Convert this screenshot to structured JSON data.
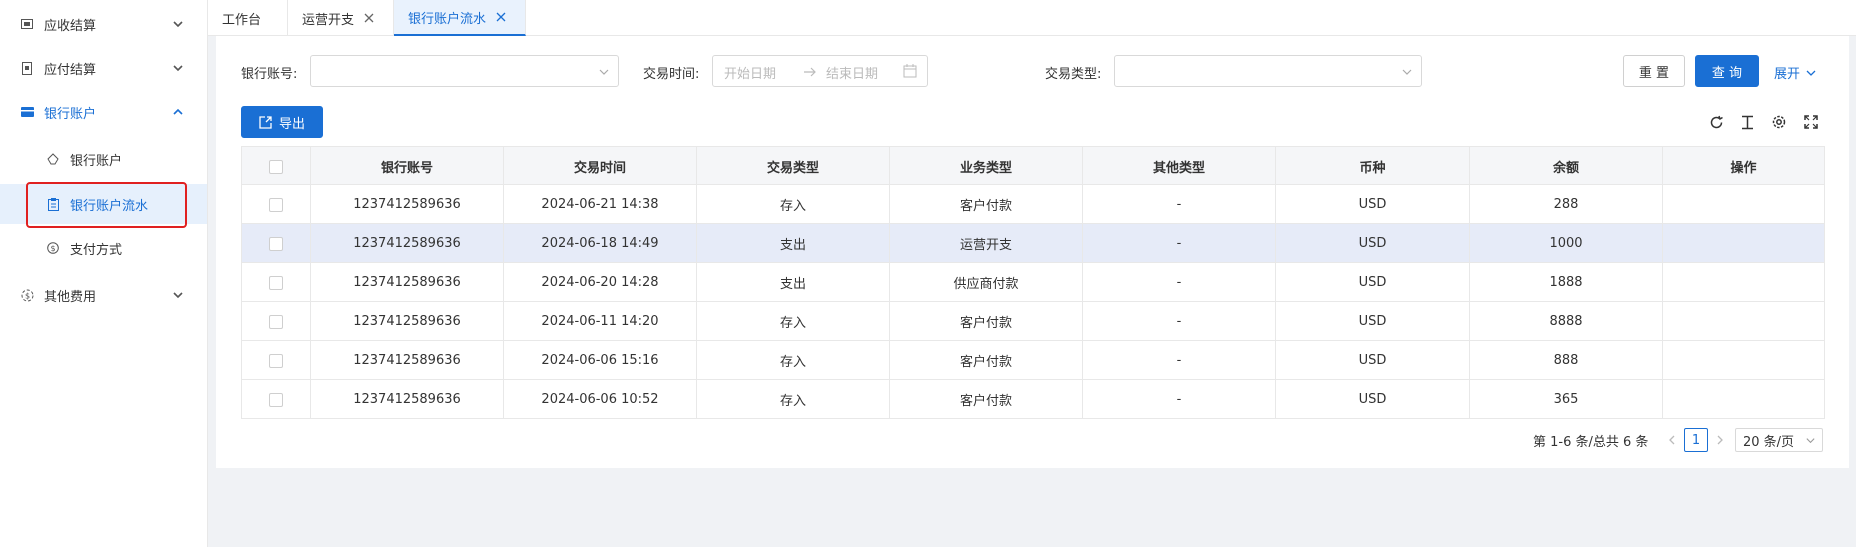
{
  "sidebar": {
    "items": [
      {
        "label": "应收结算",
        "icon": "receivable-icon"
      },
      {
        "label": "应付结算",
        "icon": "payable-icon"
      },
      {
        "label": "银行账户",
        "icon": "bank-card-icon"
      },
      {
        "label": "其他费用",
        "icon": "other-fee-icon"
      }
    ],
    "sub_items": [
      {
        "label": "银行账户",
        "icon": "bank-icon"
      },
      {
        "label": "银行账户流水",
        "icon": "clipboard-icon"
      },
      {
        "label": "支付方式",
        "icon": "payment-icon"
      }
    ]
  },
  "tabs": [
    {
      "label": "工作台"
    },
    {
      "label": "运营开支"
    },
    {
      "label": "银行账户流水"
    }
  ],
  "filters": {
    "account_label": "银行账号:",
    "time_label": "交易时间:",
    "start_placeholder": "开始日期",
    "end_placeholder": "结束日期",
    "type_label": "交易类型:",
    "reset": "重 置",
    "query": "查 询",
    "expand": "展开"
  },
  "toolbar": {
    "export": "导出"
  },
  "table": {
    "headers": [
      "银行账号",
      "交易时间",
      "交易类型",
      "业务类型",
      "其他类型",
      "币种",
      "余额",
      "操作"
    ],
    "rows": [
      [
        "1237412589636",
        "2024-06-21 14:38",
        "存入",
        "客户付款",
        "-",
        "USD",
        "288",
        ""
      ],
      [
        "1237412589636",
        "2024-06-18 14:49",
        "支出",
        "运营开支",
        "-",
        "USD",
        "1000",
        ""
      ],
      [
        "1237412589636",
        "2024-06-20 14:28",
        "支出",
        "供应商付款",
        "-",
        "USD",
        "1888",
        ""
      ],
      [
        "1237412589636",
        "2024-06-11 14:20",
        "存入",
        "客户付款",
        "-",
        "USD",
        "8888",
        ""
      ],
      [
        "1237412589636",
        "2024-06-06 15:16",
        "存入",
        "客户付款",
        "-",
        "USD",
        "888",
        ""
      ],
      [
        "1237412589636",
        "2024-06-06 10:52",
        "存入",
        "客户付款",
        "-",
        "USD",
        "365",
        ""
      ]
    ]
  },
  "pagination": {
    "summary": "第 1-6 条/总共 6 条",
    "current": "1",
    "page_size": "20 条/页"
  },
  "colors": {
    "primary": "#1a6fd4",
    "highlight_row": "#e6ebf8",
    "red_box": "#e02020"
  }
}
